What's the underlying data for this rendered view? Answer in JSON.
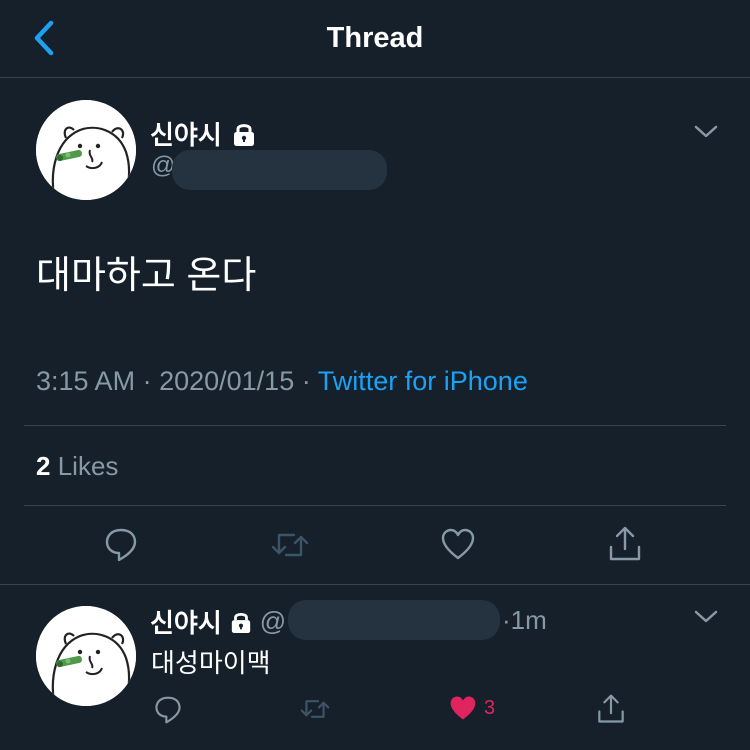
{
  "header": {
    "title": "Thread",
    "back_icon": "chevron-left-icon"
  },
  "main_tweet": {
    "display_name": "신야시",
    "handle_prefix": "@",
    "text": "대마하고 온다",
    "time": "3:15 AM",
    "date": "2020/01/15",
    "source": "Twitter for iPhone",
    "likes_count": "2",
    "likes_label": "Likes"
  },
  "reply_tweet": {
    "display_name": "신야시",
    "handle_prefix": "@",
    "time": "1m",
    "text": "대성마이맥",
    "like_count": "3"
  },
  "colors": {
    "background": "#15202b",
    "divider": "#38444d",
    "secondary_text": "#8899a6",
    "accent_blue": "#1da1f2",
    "like_pink": "#e0245e"
  }
}
